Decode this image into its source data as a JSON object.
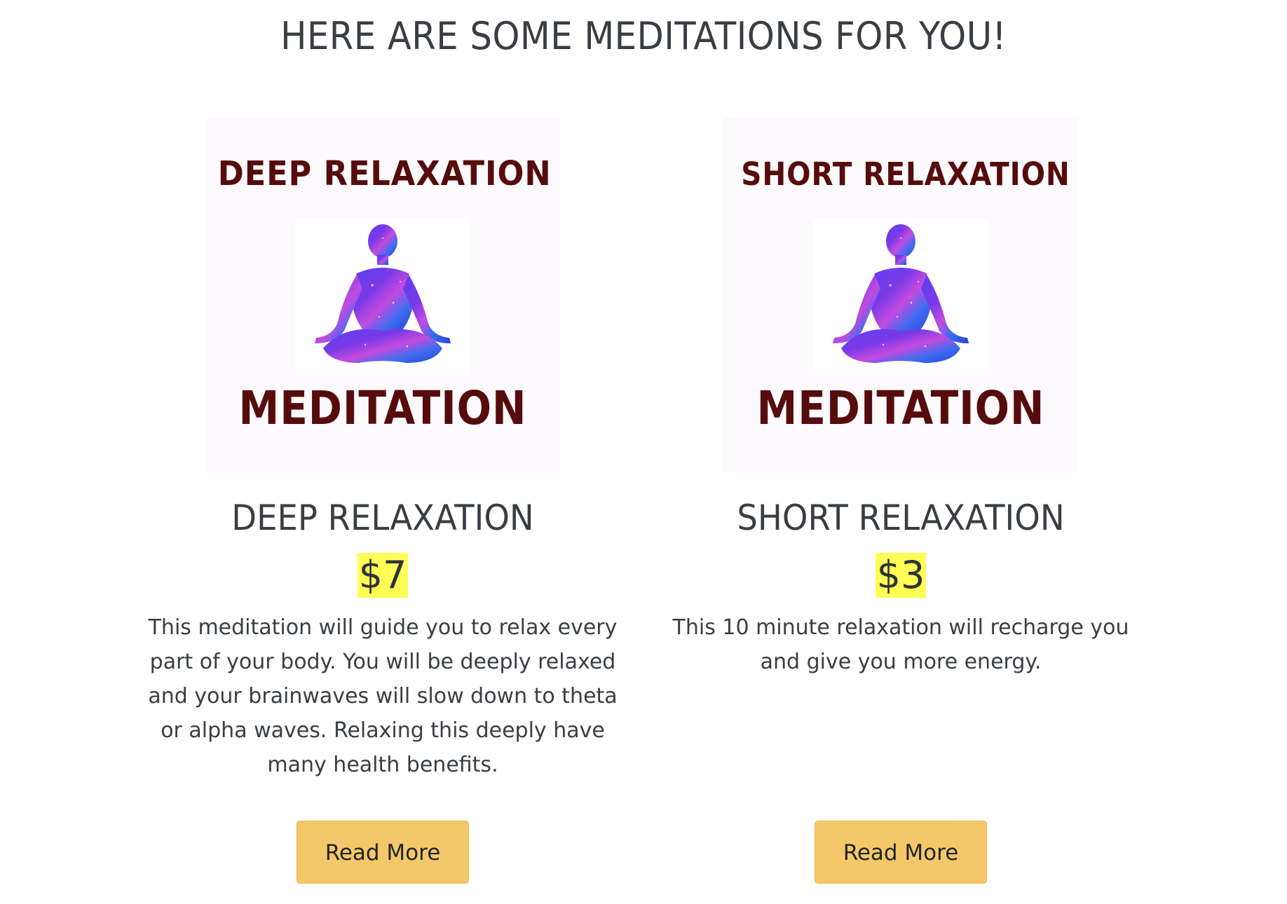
{
  "page": {
    "heading": "HERE ARE SOME MEDITATIONS FOR YOU!"
  },
  "meditations": [
    {
      "image_title_top": "DEEP RELAXATION",
      "image_title_bottom": "MEDITATION",
      "title": "DEEP RELAXATION",
      "price": "$7",
      "description": "This meditation will guide you to relax every part of your body. You will be deeply relaxed and your brainwaves will slow down to theta or alpha waves. Relaxing this deeply have many health benefits.",
      "button_label": "Read More"
    },
    {
      "image_title_top": "SHORT RELAXATION",
      "image_title_bottom": "MEDITATION",
      "title": "SHORT RELAXATION",
      "price": "$3",
      "description": "This 10 minute relaxation will recharge you and give you more energy.",
      "button_label": "Read More"
    }
  ],
  "colors": {
    "price_highlight": "#ffff55",
    "button_bg": "#f4c86a",
    "image_text": "#560c0c",
    "text": "#3a3d42"
  },
  "icons": {
    "figure": "meditating-figure-icon"
  }
}
